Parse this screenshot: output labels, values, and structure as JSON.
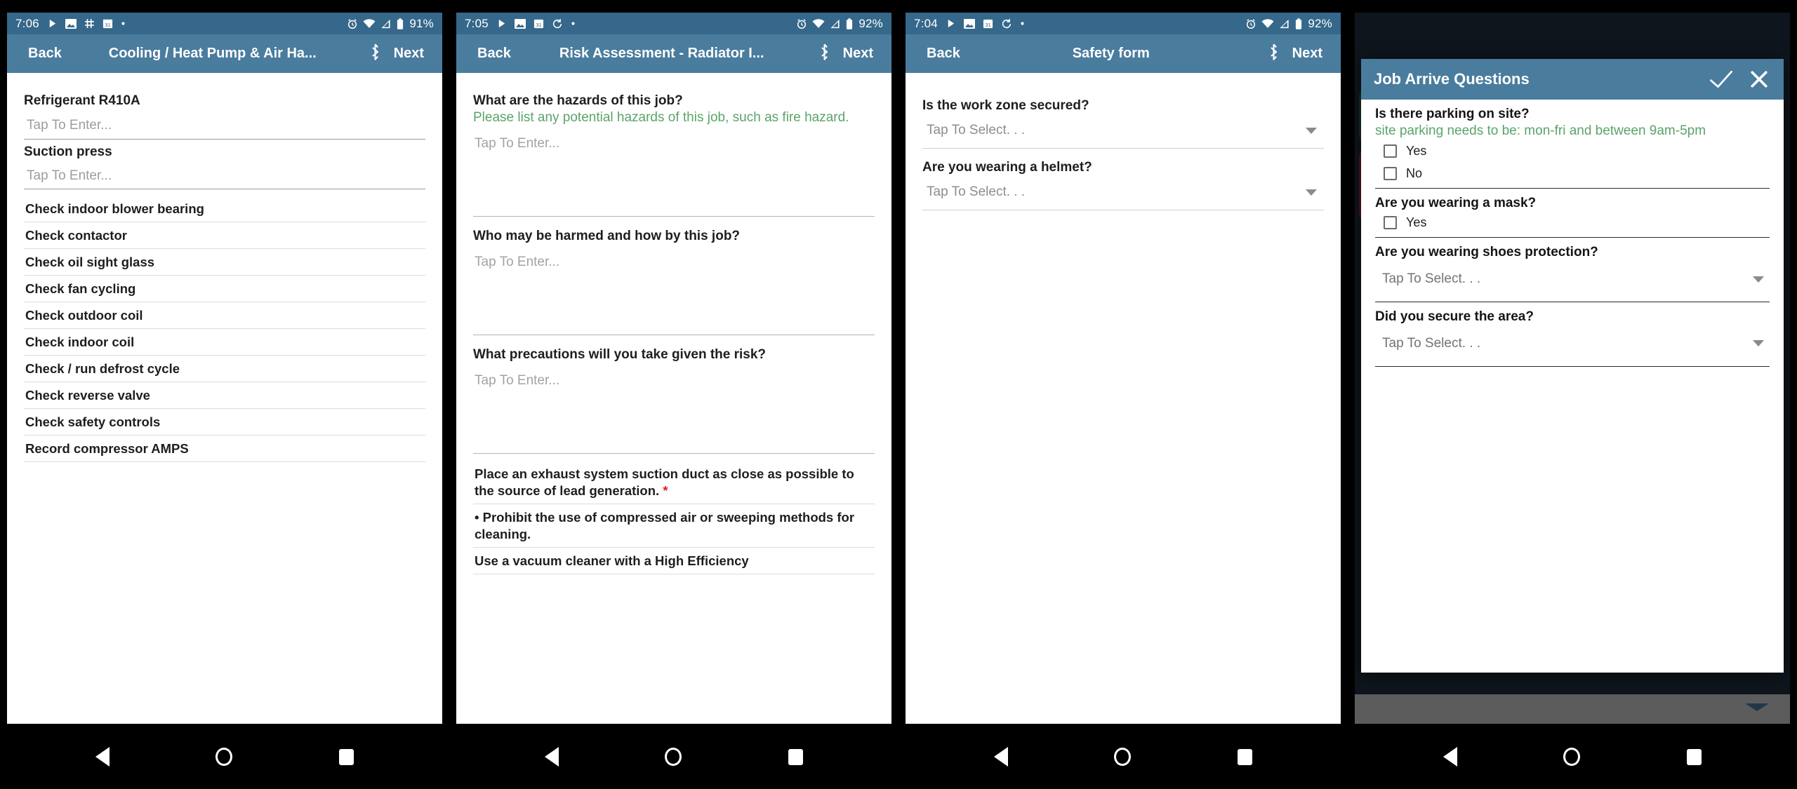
{
  "phones": [
    {
      "status": {
        "time": "7:06",
        "battery": "91%",
        "left_icons": [
          "play-icon",
          "image-icon",
          "slack-icon",
          "calendar-icon",
          "dot-icon"
        ],
        "right_icons": [
          "alarm-icon",
          "wifi-icon",
          "signal-icon",
          "battery-icon"
        ]
      },
      "appbar": {
        "back": "Back",
        "title": "Cooling / Heat Pump & Air Ha...",
        "bluetooth": "bluetooth-icon",
        "next": "Next"
      },
      "fields": [
        {
          "label": "Refrigerant R410A",
          "placeholder": "Tap To Enter..."
        },
        {
          "label": "Suction press",
          "placeholder": "Tap To Enter..."
        }
      ],
      "checklist": [
        "Check indoor blower bearing",
        "Check contactor",
        "Check oil sight glass",
        "Check fan cycling",
        "Check outdoor coil",
        "Check indoor coil",
        "Check / run defrost cycle",
        "Check reverse valve",
        "Check safety controls",
        "Record compressor AMPS"
      ]
    },
    {
      "status": {
        "time": "7:05",
        "battery": "92%",
        "left_icons": [
          "play-icon",
          "image-icon",
          "calendar-icon",
          "sync-icon",
          "dot-icon"
        ],
        "right_icons": [
          "alarm-icon",
          "wifi-icon",
          "signal-icon",
          "battery-icon"
        ]
      },
      "appbar": {
        "back": "Back",
        "title": "Risk Assessment - Radiator I...",
        "bluetooth": "bluetooth-icon",
        "next": "Next"
      },
      "questions": [
        {
          "label": "What are the hazards of this job?",
          "hint": "Please list any potential hazards of this job, such as fire hazard.",
          "placeholder": "Tap To Enter..."
        },
        {
          "label": "Who may be harmed and how by this job?",
          "hint": "",
          "placeholder": "Tap To Enter..."
        },
        {
          "label": "What precautions will you take given the risk?",
          "hint": "",
          "placeholder": "Tap To Enter..."
        }
      ],
      "rows": [
        {
          "text": "Place an exhaust system suction duct as close as possible to the source of lead generation.",
          "required": "*"
        },
        {
          "text": "• Prohibit the use of compressed air or sweeping methods for cleaning.",
          "required": ""
        },
        {
          "text": "Use a vacuum cleaner with a High Efficiency",
          "required": ""
        }
      ]
    },
    {
      "status": {
        "time": "7:04",
        "battery": "92%",
        "left_icons": [
          "play-icon",
          "image-icon",
          "calendar-icon",
          "sync-icon",
          "dot-icon"
        ],
        "right_icons": [
          "alarm-icon",
          "wifi-icon",
          "signal-icon",
          "battery-icon"
        ]
      },
      "appbar": {
        "back": "Back",
        "title": "Safety form",
        "bluetooth": "bluetooth-icon",
        "next": "Next"
      },
      "selects": [
        {
          "label": "Is the work zone secured?",
          "placeholder": "Tap To Select. . ."
        },
        {
          "label": "Are you wearing a helmet?",
          "placeholder": "Tap To Select. . ."
        }
      ]
    },
    {
      "dialog": {
        "title": "Job Arrive Questions",
        "confirm_icon": "check-icon",
        "close_icon": "close-icon",
        "q1": {
          "label": "Is there parking on site?",
          "hint": "site parking needs to be: mon-fri and between 9am-5pm",
          "options": [
            "Yes",
            "No"
          ]
        },
        "q2": {
          "label": "Are you wearing a mask?",
          "options": [
            "Yes"
          ]
        },
        "q3": {
          "label": "Are you wearing shoes protection?",
          "placeholder": "Tap To Select. . ."
        },
        "q4": {
          "label": "Did you secure the area?",
          "placeholder": "Tap To Select. . ."
        }
      }
    }
  ],
  "navbar": {
    "back": "nav-back-icon",
    "home": "nav-home-icon",
    "recent": "nav-recent-icon"
  },
  "colors": {
    "statusbar": "#35688a",
    "appbar": "#4a7c9e",
    "hint": "#5aa469",
    "required": "#e02020"
  }
}
